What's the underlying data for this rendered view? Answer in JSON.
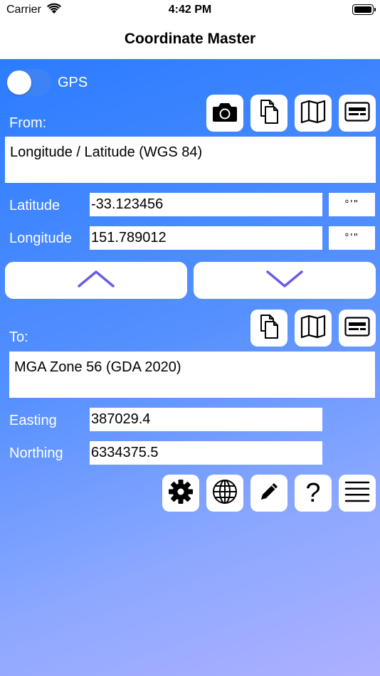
{
  "status_bar": {
    "carrier": "Carrier",
    "time": "4:42 PM"
  },
  "nav": {
    "title": "Coordinate Master"
  },
  "gps": {
    "label": "GPS",
    "enabled": false
  },
  "from": {
    "label": "From:",
    "system": "Longitude / Latitude (WGS 84)",
    "fields": [
      {
        "label": "Latitude",
        "value": "-33.123456",
        "format_button": "°'\""
      },
      {
        "label": "Longitude",
        "value": "151.789012",
        "format_button": "°'\""
      }
    ],
    "toolbar": [
      "camera-icon",
      "copy-icon",
      "map-icon",
      "card-icon"
    ]
  },
  "to": {
    "label": "To:",
    "system": "MGA Zone 56 (GDA 2020)",
    "fields": [
      {
        "label": "Easting",
        "value": "387029.4"
      },
      {
        "label": "Northing",
        "value": "6334375.5"
      }
    ],
    "toolbar": [
      "copy-icon",
      "map-icon",
      "card-icon"
    ]
  },
  "bottom_toolbar": [
    "gear-icon",
    "globe-icon",
    "pencil-icon",
    "help-icon",
    "menu-icon"
  ],
  "help_glyph": "?",
  "colors": {
    "accent": "#6a5ce8",
    "toggle_off": "#3d83f6",
    "gradient_start": "#2b7cff",
    "gradient_end": "#aeb0ff"
  }
}
